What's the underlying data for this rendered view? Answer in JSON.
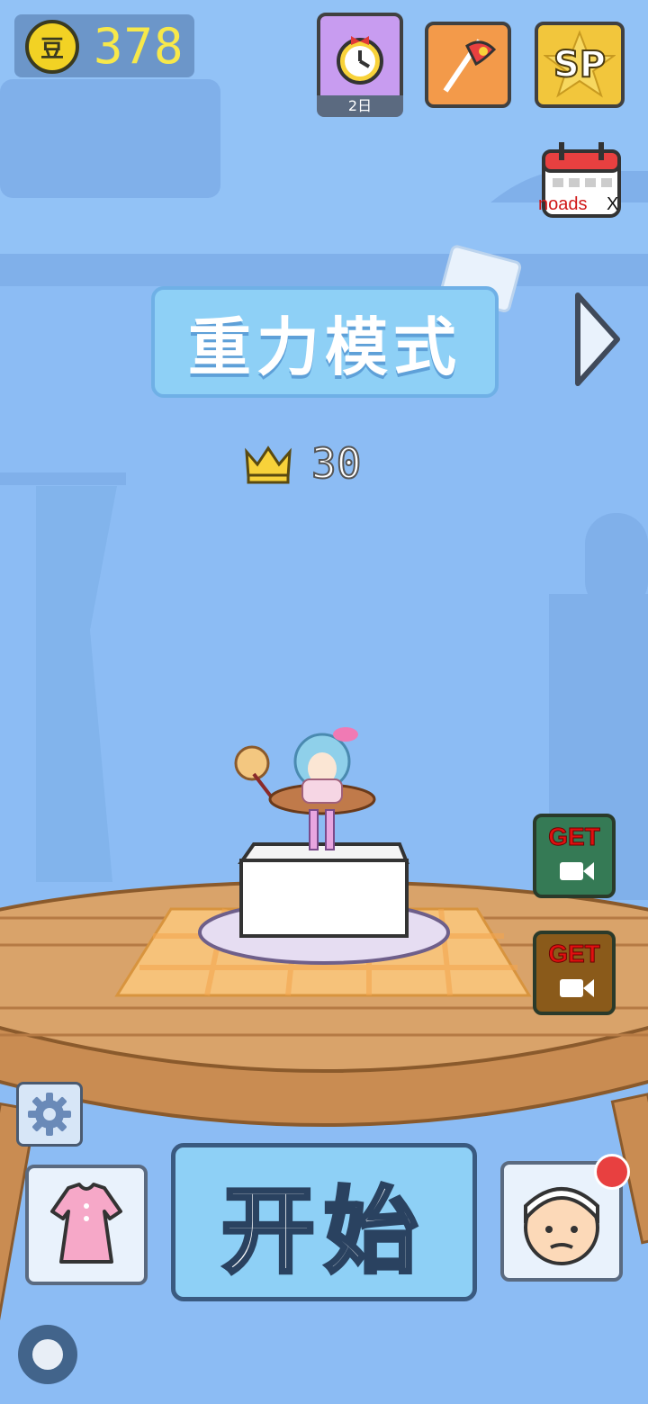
{
  "hud": {
    "coins": "378",
    "coin_icon_char": "豆",
    "timer_label": "2日",
    "sp_label": "SP",
    "noads_label": "noads",
    "noads_close": "X"
  },
  "mode": {
    "title": "重力模式",
    "best_score": "30"
  },
  "rewards": {
    "get_label_1": "GET",
    "get_label_2": "GET"
  },
  "bottom": {
    "start_label": "开始"
  },
  "colors": {
    "background": "#8cbcf4",
    "coin_text": "#f7e84a",
    "banner": "#8ed0f6",
    "get_text": "#e01010",
    "notification": "#e84040"
  }
}
